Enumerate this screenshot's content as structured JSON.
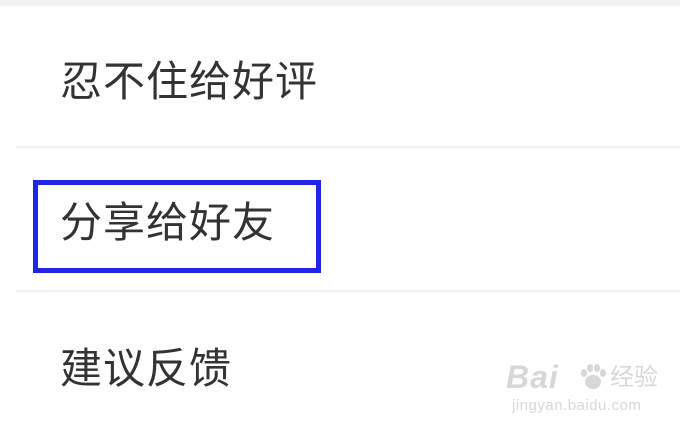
{
  "menu": {
    "items": [
      {
        "label": "忍不住给好评"
      },
      {
        "label": "分享给好友"
      },
      {
        "label": "建议反馈"
      }
    ]
  },
  "watermark": {
    "logo_text": "Bai",
    "logo_cn": "经验",
    "url": "jingyan.baidu.com",
    "color": "#d7d7d7"
  },
  "colors": {
    "highlight": "#1f26e8",
    "text": "#333333",
    "divider": "#efefef"
  }
}
